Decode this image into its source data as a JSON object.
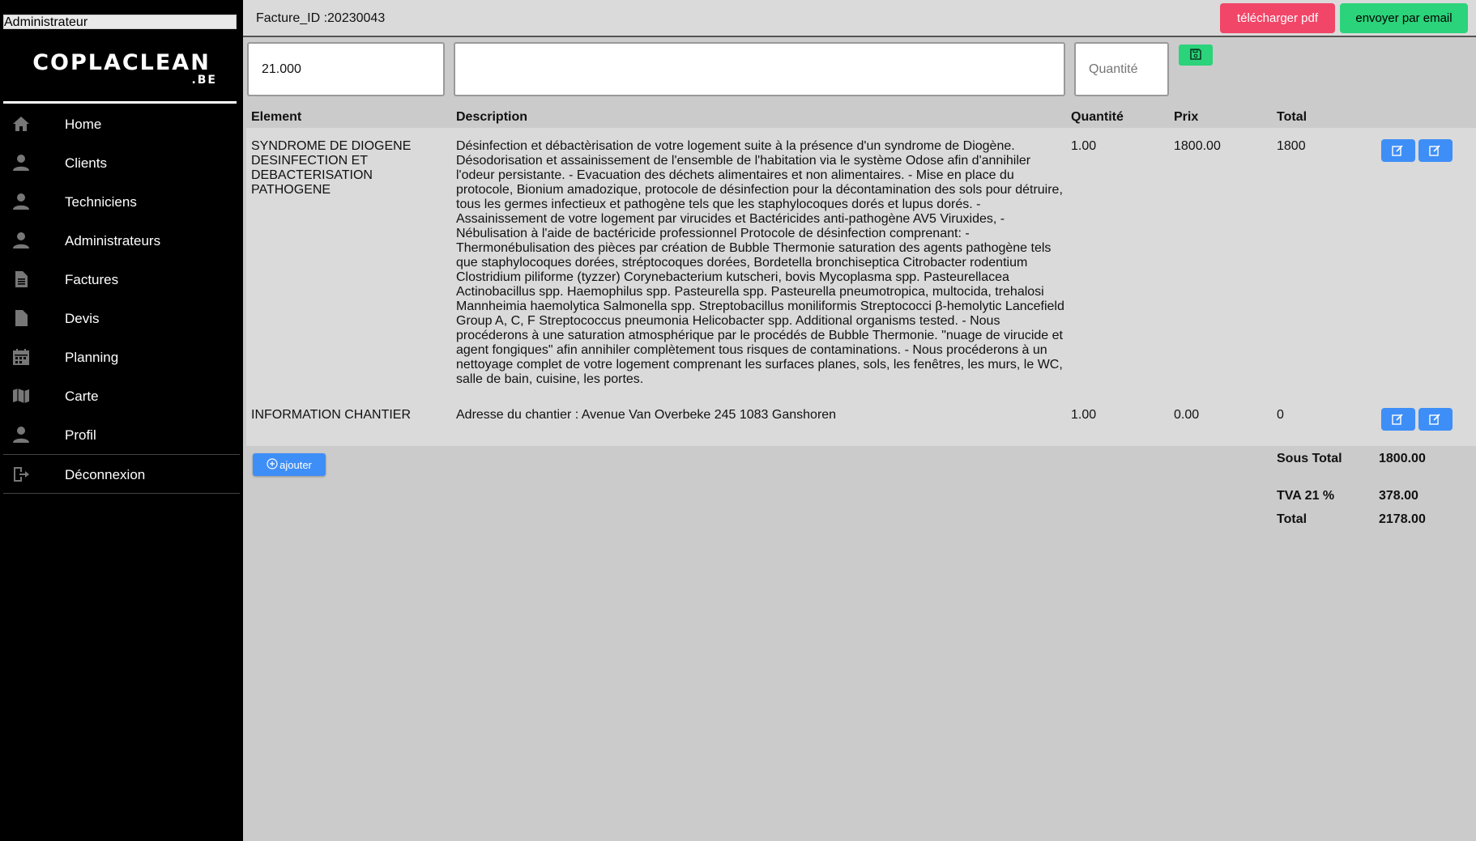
{
  "sidebar": {
    "role_select": "Administrateur",
    "logo_main": "COPLACLEAN",
    "logo_sub": ".BE",
    "items": [
      {
        "label": "Home",
        "icon": "home-icon"
      },
      {
        "label": "Clients",
        "icon": "user-icon"
      },
      {
        "label": "Techniciens",
        "icon": "user-icon"
      },
      {
        "label": "Administrateurs",
        "icon": "user-icon"
      },
      {
        "label": "Factures",
        "icon": "document-icon"
      },
      {
        "label": "Devis",
        "icon": "file-icon"
      },
      {
        "label": "Planning",
        "icon": "calendar-icon"
      },
      {
        "label": "Carte",
        "icon": "map-icon"
      },
      {
        "label": "Profil",
        "icon": "user-icon"
      }
    ],
    "logout": {
      "label": "Déconnexion",
      "icon": "logout-icon"
    }
  },
  "header": {
    "invoice_id": "Facture_ID :20230043",
    "pdf_button": "télécharger pdf",
    "email_button": "envoyer par email"
  },
  "form": {
    "element_value": "21.000",
    "description_value": "",
    "quantity_placeholder": "Quantité"
  },
  "table": {
    "headers": {
      "element": "Element",
      "description": "Description",
      "quantity": "Quantité",
      "price": "Prix",
      "total": "Total"
    },
    "rows": [
      {
        "element": "SYNDROME DE DIOGENE DESINFECTION ET DEBACTERISATION PATHOGENE",
        "description": "Désinfection et débactèrisation de votre logement suite à la présence d'un syndrome de Diogène. Désodorisation et assainissement de l'ensemble de l'habitation via le système Odose afin d'annihiler l'odeur persistante. - Evacuation des déchets alimentaires et non alimentaires. - Mise en place du protocole, Bionium amadozique, protocole de désinfection pour la décontamination des sols pour détruire, tous les germes infectieux et pathogène tels que les staphylocoques dorés et lupus dorés. - Assainissement de votre logement par virucides et Bactéricides anti-pathogène AV5 Viruxides, - Nébulisation à l'aide de bactéricide professionnel Protocole de désinfection comprenant: - Thermonébulisation des pièces par création de Bubble Thermonie saturation des agents pathogène tels que staphylocoques dorées, stréptocoques dorées, Bordetella bronchiseptica Citrobacter rodentium Clostridium piliforme (tyzzer) Corynebacterium kutscheri, bovis Mycoplasma spp. Pasteurellacea Actinobacillus spp. Haemophilus spp. Pasteurella spp. Pasteurella pneumotropica, multocida, trehalosi Mannheimia haemolytica Salmonella spp. Streptobacillus moniliformis Streptococci β-hemolytic Lancefield Group A, C, F Streptococcus pneumonia Helicobacter spp. Additional organisms tested. - Nous procéderons à une saturation atmosphérique par le procédés de Bubble Thermonie. \"nuage de virucide et agent fongiques\" afin annihiler complètement tous risques de contaminations. - Nous procéderons à un nettoyage complet de votre logement comprenant les surfaces planes, sols, les fenêtres, les murs, le WC, salle de bain, cuisine, les portes.",
        "quantity": "1.00",
        "price": "1800.00",
        "total": "1800"
      },
      {
        "element": "INFORMATION CHANTIER",
        "description": "Adresse du chantier : Avenue Van Overbeke 245 1083 Ganshoren",
        "quantity": "1.00",
        "price": "0.00",
        "total": "0"
      }
    ]
  },
  "add_button": "ajouter",
  "totals": {
    "subtotal_label": "Sous Total",
    "subtotal_value": "1800.00",
    "vat_label": "TVA 21 %",
    "vat_value": "378.00",
    "total_label": "Total",
    "total_value": "2178.00"
  },
  "colors": {
    "pdf_button": "#f14668",
    "email_button": "#2bd37a",
    "edit_button": "#3e8ef7",
    "sidebar": "#000000"
  }
}
